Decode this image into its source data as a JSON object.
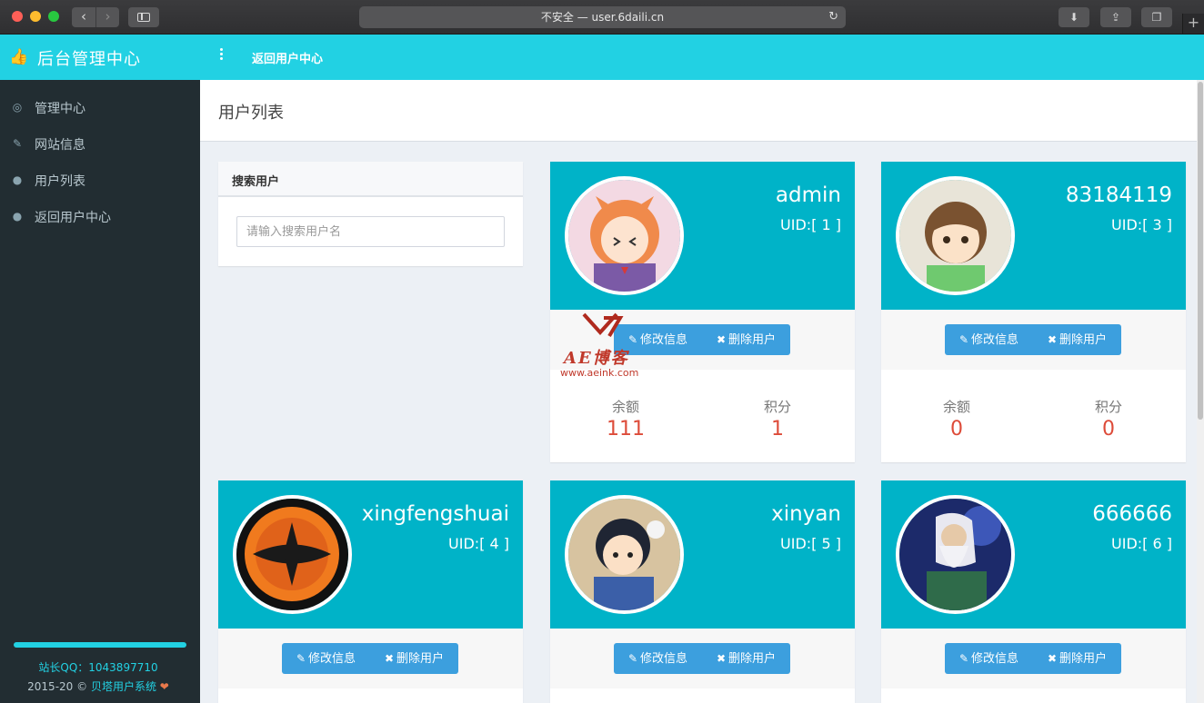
{
  "browser": {
    "url_text": "不安全 — user.6daili.cn"
  },
  "header": {
    "brand": "后台管理中心",
    "back_link": "返回用户中心"
  },
  "sidebar": {
    "items": [
      {
        "label": "管理中心",
        "icon": "dashboard-icon"
      },
      {
        "label": "网站信息",
        "icon": "pencil-icon"
      },
      {
        "label": "用户列表",
        "icon": "user-icon"
      },
      {
        "label": "返回用户中心",
        "icon": "user-icon"
      }
    ],
    "footer_qq": "站长QQ：1043897710",
    "footer_copy": "2015-20 ©",
    "footer_system": "贝塔用户系统"
  },
  "page": {
    "title": "用户列表"
  },
  "search": {
    "title": "搜索用户",
    "placeholder": "请输入搜索用户名"
  },
  "buttons": {
    "edit": "修改信息",
    "delete": "删除用户"
  },
  "stats_labels": {
    "balance": "余额",
    "points": "积分"
  },
  "users": [
    {
      "name": "admin",
      "uid": "UID:[ 1 ]",
      "balance": "111",
      "points": "1"
    },
    {
      "name": "83184119",
      "uid": "UID:[ 3 ]",
      "balance": "0",
      "points": "0"
    },
    {
      "name": "xingfengshuai",
      "uid": "UID:[ 4 ]"
    },
    {
      "name": "xinyan",
      "uid": "UID:[ 5 ]"
    },
    {
      "name": "666666",
      "uid": "UID:[ 6 ]"
    }
  ],
  "watermark": {
    "name": "AE博客",
    "url": "www.aeink.com"
  },
  "colors": {
    "header": "#22d1e3",
    "card_top": "#00b3c8",
    "button": "#3c9fde",
    "sidebar": "#222d32",
    "stat_value": "#dd4b39"
  }
}
